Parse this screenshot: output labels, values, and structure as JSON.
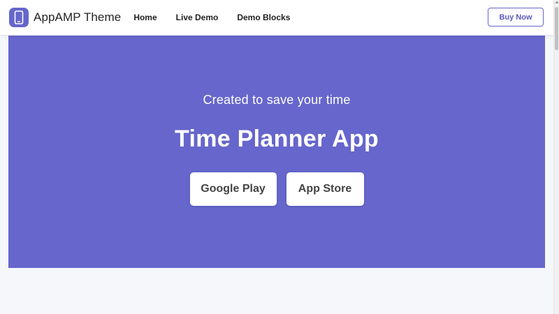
{
  "navbar": {
    "brand_name": "AppAMP Theme",
    "brand_icon": "mobile-phone-icon",
    "links": [
      {
        "label": "Home"
      },
      {
        "label": "Live Demo"
      },
      {
        "label": "Demo Blocks"
      }
    ],
    "buy_button_label": "Buy Now"
  },
  "hero": {
    "subtitle": "Created to save your time",
    "title": "Time Planner App",
    "buttons": {
      "google_play": "Google Play",
      "app_store": "App Store"
    }
  },
  "colors": {
    "accent": "#6666cc",
    "page_background": "#f6f7fb",
    "button_text": "#444444"
  }
}
